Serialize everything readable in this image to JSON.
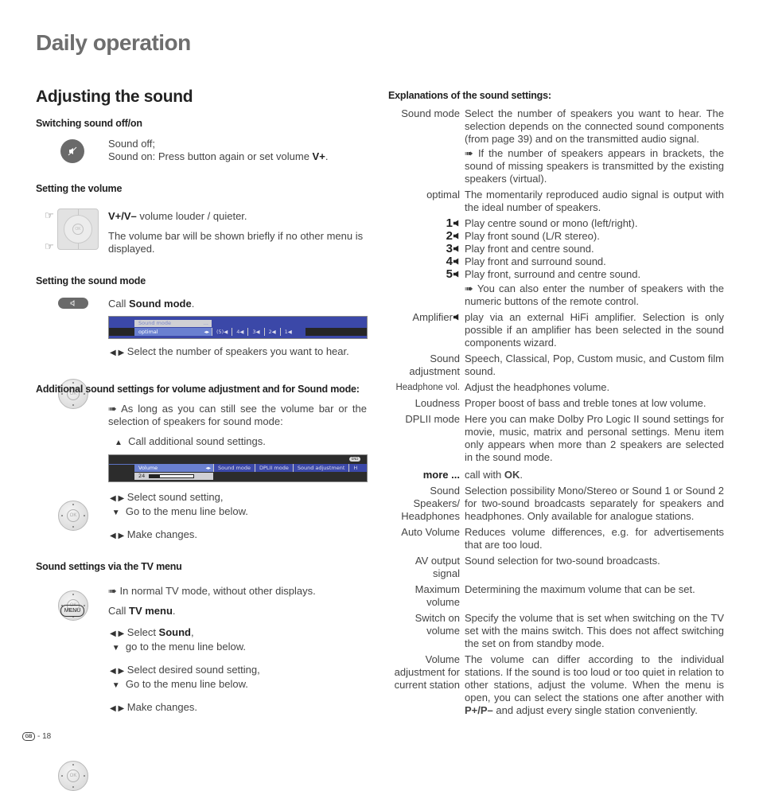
{
  "page_title": "Daily operation",
  "section_title": "Adjusting the sound",
  "left": {
    "switch": {
      "heading": "Switching sound off/on",
      "line1": "Sound off;",
      "line2_pre": "Sound on: Press button again or set volume ",
      "line2_bold": "V+",
      "line2_post": "."
    },
    "volume": {
      "heading": "Setting the volume",
      "line1_bold": "V+/V–",
      "line1_rest": " volume louder / quieter.",
      "line2": "The volume bar will be shown briefly if no other menu is displayed."
    },
    "sound_mode": {
      "heading": "Setting the sound mode",
      "call_pre": "Call ",
      "call_bold": "Sound mode",
      "call_post": ".",
      "osd": {
        "title": "Sound mode",
        "title_more": "...",
        "selected": "optimal",
        "options": [
          "(5)",
          "4",
          "3",
          "2",
          "1"
        ]
      },
      "select_text": "Select the number of speakers you want to hear."
    },
    "additional": {
      "heading": "Additional sound settings for volume adjustment and for Sound mode:",
      "note": "As long as you can still see the volume bar or the selection of speakers for sound mode:",
      "up_text": "Call additional sound settings.",
      "osd": {
        "end_badge": "END",
        "selected": "Volume",
        "value": "24",
        "volume_level": 0.24,
        "items": [
          "Sound mode",
          "DPLII mode",
          "Sound adjustment",
          "H"
        ]
      },
      "step1": "Select sound setting,",
      "step1b": "Go to the menu line below.",
      "step2": "Make changes."
    },
    "tv_menu": {
      "heading": "Sound settings via the TV menu",
      "note": "In normal TV mode, without other displays.",
      "menu_button": "MENU",
      "call_pre": "Call ",
      "call_bold": "TV menu",
      "call_post": ".",
      "step1_pre": "Select ",
      "step1_bold": "Sound",
      "step1_post": ",",
      "step1b": "go to the menu line below.",
      "step2": "Select desired sound setting,",
      "step2b": "Go to the menu line below.",
      "step3": "Make changes."
    }
  },
  "right": {
    "heading": "Explanations of the sound settings:",
    "sound_mode_term": "Sound mode",
    "sound_mode_def": "Select the number of speakers you want to hear. The selection depends on the connected sound components (from page 39) and on the transmitted audio signal.",
    "sound_mode_note": "If the number of speakers appears in brackets, the sound of missing speakers is transmitted by the existing speakers (virtual).",
    "optimal_term": "optimal",
    "optimal_def": "The momentarily reproduced audio signal is output with the ideal number of speakers.",
    "speakers": [
      {
        "n": "1",
        "text": "Play centre sound or mono (left/right)."
      },
      {
        "n": "2",
        "text": "Play front sound (L/R stereo)."
      },
      {
        "n": "3",
        "text": "Play front and centre sound."
      },
      {
        "n": "4",
        "text": "Play front and surround sound."
      },
      {
        "n": "5",
        "text": "Play front, surround and centre sound."
      }
    ],
    "speakers_note": "You can also enter the number of speakers with the numeric buttons of the remote control.",
    "amplifier_term": "Amplifier",
    "amplifier_def": "play via an external HiFi amplifier. Selection is only possible if an amplifier has been selected in the sound components wizard.",
    "items": [
      {
        "term": "Sound adjustment",
        "def": "Speech, Classical, Pop, Custom music, and Custom film sound."
      },
      {
        "term": "Headphone vol.",
        "def": "Adjust the headphones volume."
      },
      {
        "term": "Loudness",
        "def": "Proper boost of bass and treble tones at low volume."
      },
      {
        "term": "DPLII mode",
        "def": "Here you can make Dolby Pro Logic II sound settings for movie, music, matrix and personal settings. Menu item only appears when more than 2 speakers are selected in the sound mode."
      }
    ],
    "more_term": "more ...",
    "more_def_pre": "call with ",
    "more_def_bold": "OK",
    "more_def_post": ".",
    "items2": [
      {
        "term": "Sound Speakers/ Headphones",
        "def": "Selection possibility Mono/Stereo or Sound 1 or Sound 2 for two-sound broadcasts separately for speakers and headphones. Only available for analogue stations."
      },
      {
        "term": "Auto Volume",
        "def": "Reduces volume differences, e.g. for advertisements that are too loud."
      },
      {
        "term": "AV output signal",
        "def": "Sound selection for two-sound broadcasts."
      },
      {
        "term": "Maximum volume",
        "def": "Determining the maximum volume that can be set."
      },
      {
        "term": "Switch on volume",
        "def": "Specify the volume that is set when switching on the TV set with the mains switch. This does not affect switching the set on from standby mode."
      }
    ],
    "last_term": "Volume adjustment for current station",
    "last_def_pre": "The volume can differ according to the individual stations. If the sound is too loud or too quiet in relation to other stations, adjust the volume. When the menu is open, you can select the stations one after another with ",
    "last_def_bold": "P+/P–",
    "last_def_post": " and adjust every single station conveniently."
  },
  "footer": {
    "country_badge": "GB",
    "page": "- 18"
  }
}
